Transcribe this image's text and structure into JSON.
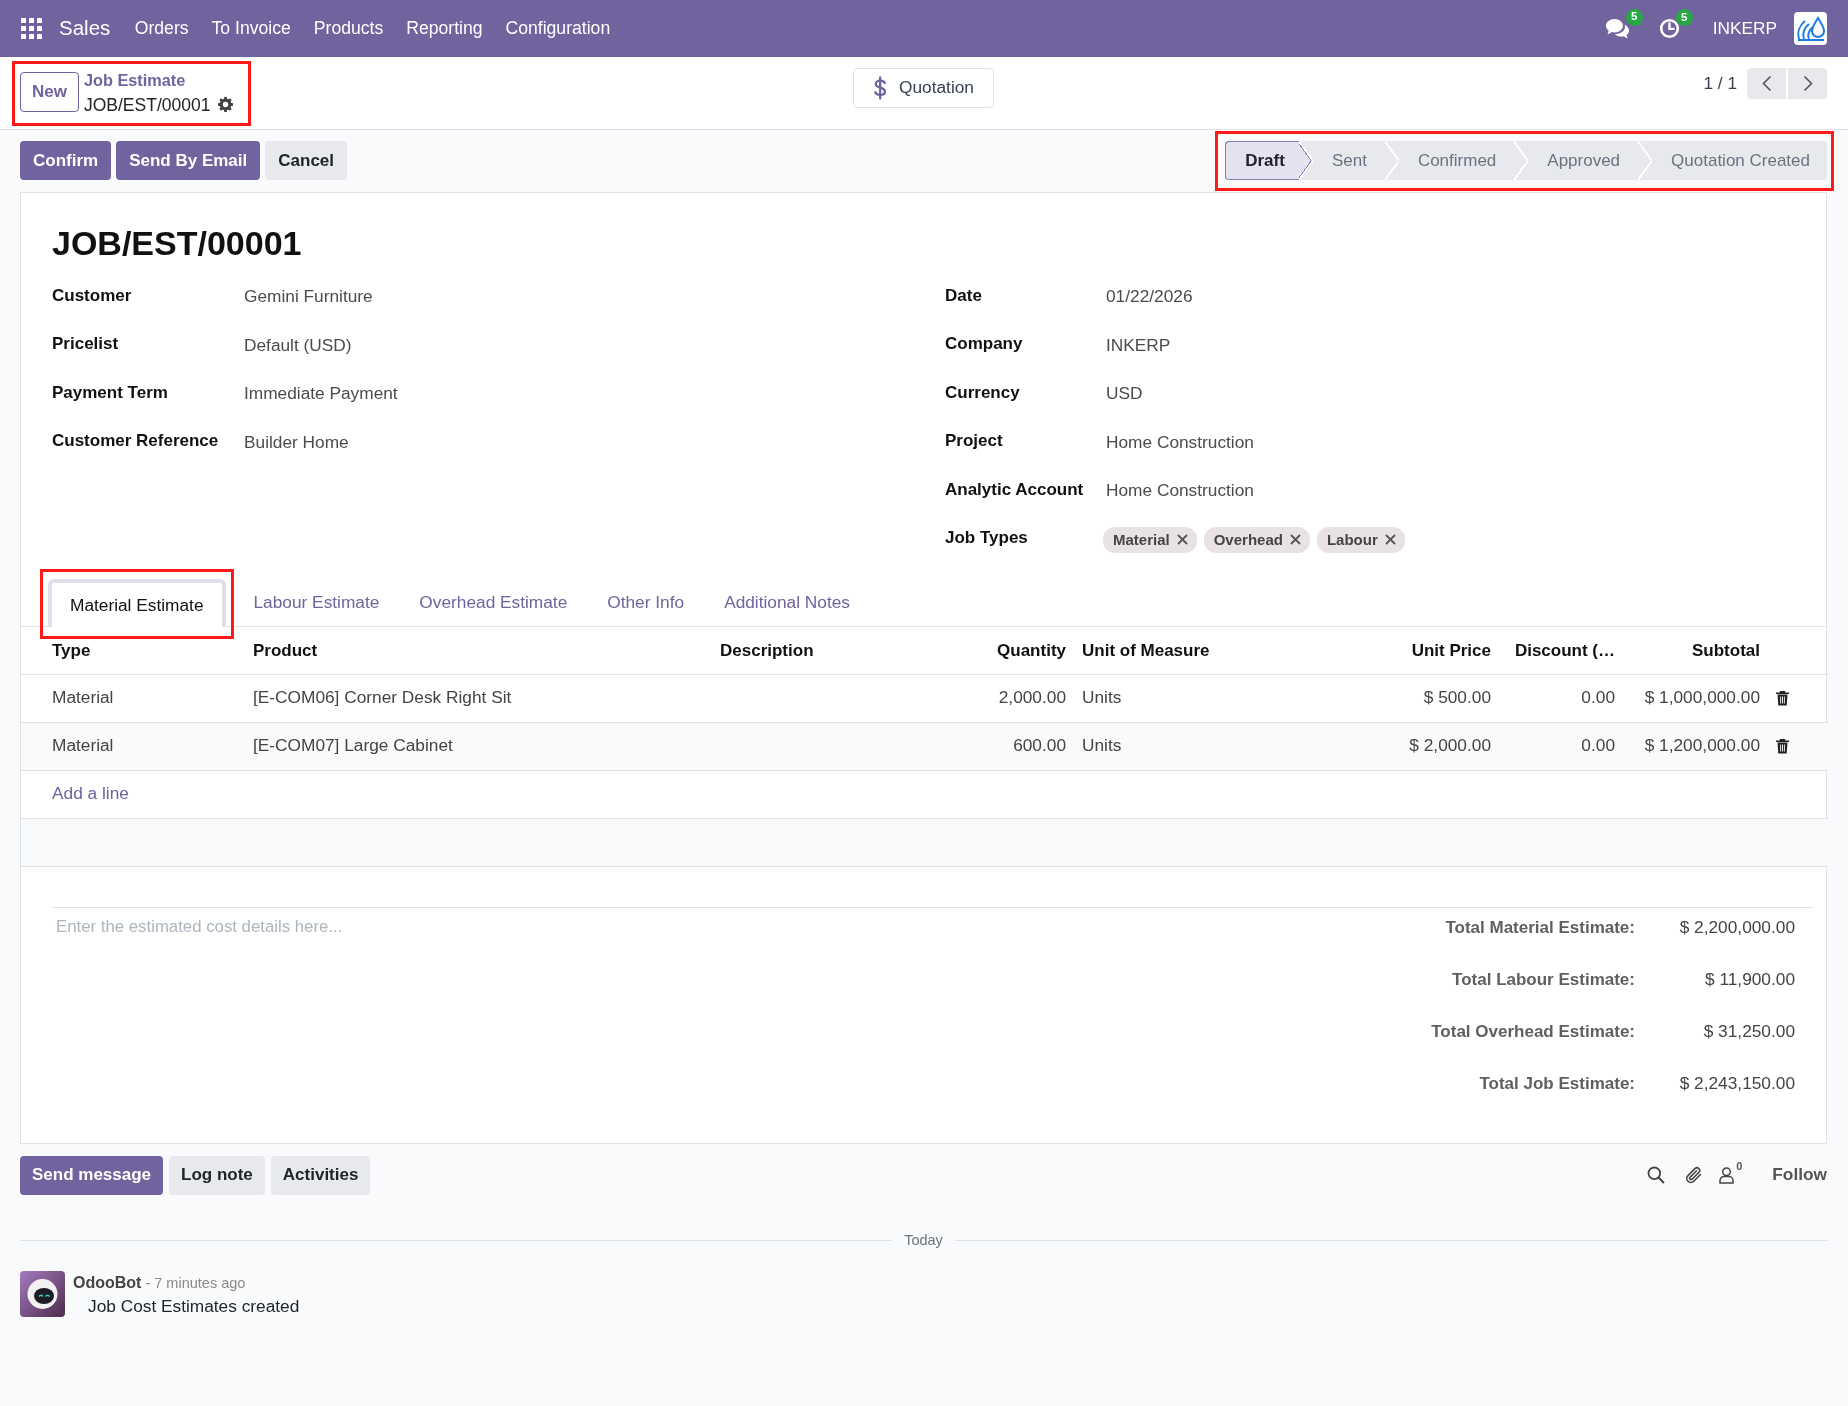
{
  "navbar": {
    "app": "Sales",
    "menu": [
      "Orders",
      "To Invoice",
      "Products",
      "Reporting",
      "Configuration"
    ],
    "messages_badge": "5",
    "activities_badge": "5",
    "company": "INKERP"
  },
  "breadcrumb": {
    "new_button": "New",
    "parent": "Job Estimate",
    "current": "JOB/EST/00001",
    "highlighted": true
  },
  "smart_button": {
    "label": "Quotation"
  },
  "pager": {
    "value": "1 / 1"
  },
  "actions": [
    {
      "label": "Confirm",
      "kind": "primary"
    },
    {
      "label": "Send By Email",
      "kind": "primary"
    },
    {
      "label": "Cancel",
      "kind": "secondary"
    }
  ],
  "status_bar": {
    "highlighted": true,
    "steps": [
      {
        "label": "Draft",
        "selected": true
      },
      {
        "label": "Sent",
        "selected": false
      },
      {
        "label": "Confirmed",
        "selected": false
      },
      {
        "label": "Approved",
        "selected": false
      },
      {
        "label": "Quotation Created",
        "selected": false
      }
    ]
  },
  "form": {
    "title": "JOB/EST/00001",
    "left_fields": [
      {
        "kind": "text",
        "label": "Customer",
        "value": "Gemini Furniture"
      },
      {
        "kind": "text",
        "label": "Pricelist",
        "value": "Default (USD)"
      },
      {
        "kind": "text",
        "label": "Payment Term",
        "value": "Immediate Payment"
      },
      {
        "kind": "text",
        "label": "Customer Reference",
        "value": "Builder Home"
      }
    ],
    "right_fields": [
      {
        "kind": "text",
        "label": "Date",
        "value": "01/22/2026"
      },
      {
        "kind": "text",
        "label": "Company",
        "value": "INKERP"
      },
      {
        "kind": "text",
        "label": "Currency",
        "value": "USD"
      },
      {
        "kind": "text",
        "label": "Project",
        "value": "Home Construction"
      },
      {
        "kind": "text",
        "label": "Analytic Account",
        "value": "Home Construction"
      },
      {
        "kind": "tags",
        "label": "Job Types",
        "tags": [
          "Material",
          "Overhead",
          "Labour"
        ]
      }
    ]
  },
  "tabs": [
    {
      "label": "Material Estimate",
      "selected": true,
      "highlighted": true
    },
    {
      "label": "Labour Estimate",
      "selected": false,
      "highlighted": false
    },
    {
      "label": "Overhead Estimate",
      "selected": false,
      "highlighted": false
    },
    {
      "label": "Other Info",
      "selected": false,
      "highlighted": false
    },
    {
      "label": "Additional Notes",
      "selected": false,
      "highlighted": false
    }
  ],
  "table": {
    "columns": [
      "Type",
      "Product",
      "Description",
      "Quantity",
      "Unit of Measure",
      "Unit Price",
      "Discount (…",
      "Subtotal"
    ],
    "rows": [
      {
        "type": "Material",
        "product": "[E-COM06] Corner Desk Right Sit",
        "quantity": "2,000.00",
        "unit": "Units",
        "unit_price": "$ 500.00",
        "discount": "0.00",
        "subtotal": "$ 1,000,000.00"
      },
      {
        "type": "Material",
        "product": "[E-COM07] Large Cabinet",
        "quantity": "600.00",
        "unit": "Units",
        "unit_price": "$ 2,000.00",
        "discount": "0.00",
        "subtotal": "$ 1,200,000.00"
      }
    ],
    "add_line": "Add a line"
  },
  "notes": {
    "placeholder": "Enter the estimated cost details here..."
  },
  "totals": [
    {
      "label": "Total Material Estimate:",
      "value": "$ 2,200,000.00"
    },
    {
      "label": "Total Labour Estimate:",
      "value": "$ 11,900.00"
    },
    {
      "label": "Total Overhead Estimate:",
      "value": "$ 31,250.00"
    },
    {
      "label": "Total Job Estimate:",
      "value": "$ 2,243,150.00"
    }
  ],
  "chatter": {
    "buttons": [
      {
        "label": "Send message",
        "kind": "primary"
      },
      {
        "label": "Log note",
        "kind": "secondary"
      },
      {
        "label": "Activities",
        "kind": "secondary"
      }
    ],
    "followers_count": "0",
    "follow": "Follow",
    "date_separator": "Today",
    "messages": [
      {
        "author": "OdooBot",
        "time": "- 7 minutes ago",
        "body": "Job Cost Estimates created"
      }
    ]
  }
}
